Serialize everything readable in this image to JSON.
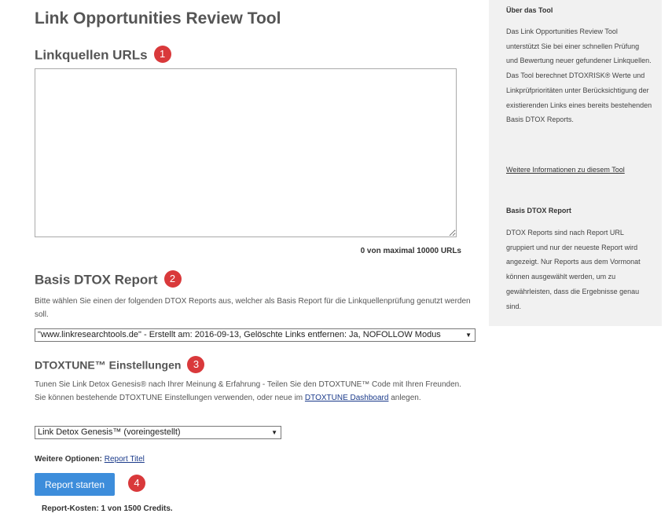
{
  "page": {
    "title": "Link Opportunities Review Tool"
  },
  "linkquellen": {
    "title": "Linkquellen URLs",
    "badge": "1",
    "textarea_value": "",
    "counter": "0 von maximal 10000 URLs"
  },
  "basis_report": {
    "title": "Basis DTOX Report",
    "badge": "2",
    "description": "Bitte wählen Sie einen der folgenden DTOX Reports aus, welcher als Basis Report für die Linkquellenprüfung genutzt werden soll.",
    "selected": "\"www.linkresearchtools.de\" - Erstellt am: 2016-09-13, Gelöschte Links entfernen: Ja, NOFOLLOW Modus"
  },
  "dtoxtune": {
    "title": "DTOXTUNE™ Einstellungen",
    "badge": "3",
    "description_before": "Tunen Sie Link Detox Genesis® nach Ihrer Meinung & Erfahrung - Teilen Sie den DTOXTUNE™ Code mit Ihren Freunden. Sie können bestehende DTOXTUNE Einstellungen verwenden, oder neue im ",
    "dashboard_link": "DTOXTUNE Dashboard",
    "description_after": " anlegen.",
    "selected": "Link Detox Genesis™ (voreingestellt)"
  },
  "more_options": {
    "label": "Weitere Optionen:",
    "link": "Report Titel"
  },
  "start": {
    "button_label": "Report starten",
    "badge": "4",
    "costs": "Report-Kosten: 1 von 1500 Credits."
  },
  "sidebar": {
    "about_title": "Über das Tool",
    "about_text": "Das Link Opportunities Review Tool unterstützt Sie bei einer schnellen Prüfung und Bewertung neuer gefundener Linkquellen. Das Tool berechnet DTOXRISK® Werte und Linkprüfprioritäten unter Berücksichtigung der existierenden Links eines bereits bestehenden Basis DTOX Reports.",
    "about_link": "Weitere Informationen zu diesem Tool",
    "basis_title": "Basis DTOX Report",
    "basis_text": "DTOX Reports sind nach Report URL gruppiert und nur der neueste Report wird angezeigt. Nur Reports aus dem Vormonat können ausgewählt werden, um zu gewährleisten, dass die Ergebnisse genau sind."
  },
  "colors": {
    "accent_button": "#3d8ddb",
    "badge_red": "#d9393b",
    "sidebar_bg": "#f1f1f1"
  }
}
